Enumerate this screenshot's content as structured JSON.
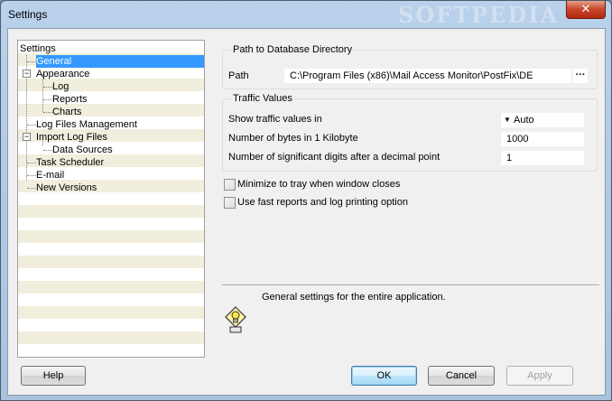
{
  "window": {
    "title": "Settings",
    "watermark": "SOFTPEDIA",
    "close_glyph": "✕"
  },
  "tree": {
    "root": "Settings",
    "items": [
      {
        "label": "General",
        "selected": true
      },
      {
        "label": "Appearance",
        "expander": "−"
      },
      {
        "label": "Log"
      },
      {
        "label": "Reports"
      },
      {
        "label": "Charts"
      },
      {
        "label": "Log Files Management"
      },
      {
        "label": "Import Log Files",
        "expander": "−"
      },
      {
        "label": "Data Sources"
      },
      {
        "label": "Task Scheduler"
      },
      {
        "label": "E-mail"
      },
      {
        "label": "New Versions"
      }
    ]
  },
  "path_group": {
    "title": "Path to Database Directory",
    "label": "Path",
    "value": "C:\\Program Files (x86)\\Mail Access Monitor\\PostFix\\DE",
    "browse": "···"
  },
  "traffic_group": {
    "title": "Traffic Values",
    "show_label": "Show traffic values in",
    "show_value": "Auto",
    "dropdown_glyph": "▼",
    "bytes_label": "Number of bytes in 1 Kilobyte",
    "bytes_value": "1000",
    "digits_label": "Number of significant digits after a decimal point",
    "digits_value": "1"
  },
  "options": {
    "minimize_label": "Minimize to tray when window closes",
    "minimize_checked": false,
    "fast_reports_label": "Use fast reports and log printing option",
    "fast_reports_checked": false
  },
  "info": {
    "text": "General settings for the entire application.",
    "icon": "lightbulb-info-icon"
  },
  "buttons": {
    "help": "Help",
    "ok": "OK",
    "cancel": "Cancel",
    "apply": "Apply"
  },
  "colors": {
    "selection": "#3399ff",
    "tree_stripe": "#f1eedd",
    "title_bar": "#b9d1ea",
    "close": "#c8452b"
  }
}
